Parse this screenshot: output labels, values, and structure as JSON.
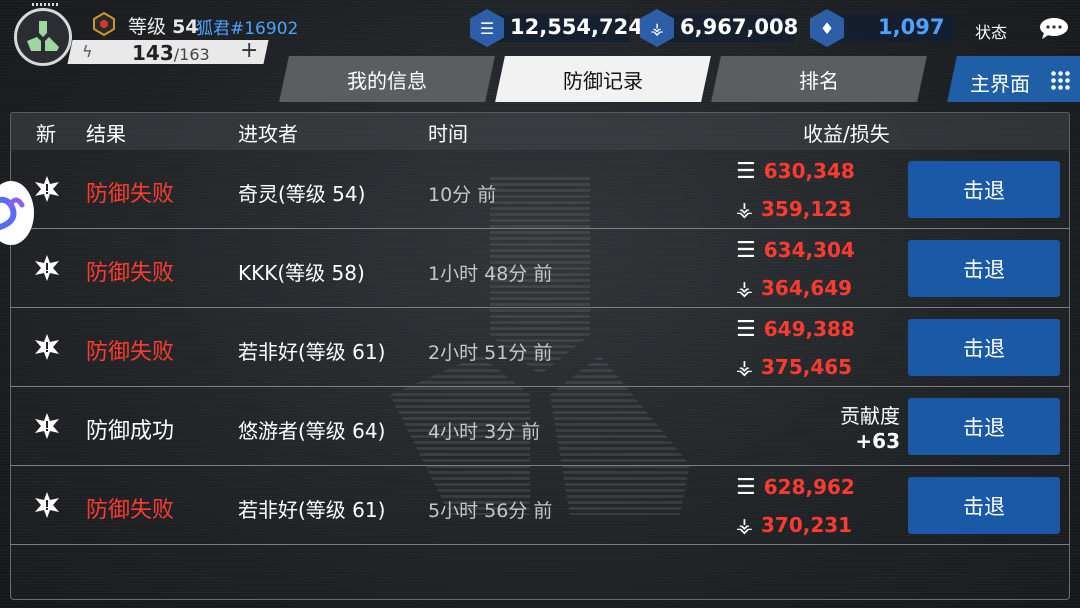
{
  "player": {
    "level_prefix": "等级",
    "level": "54",
    "name": "狐君#16902",
    "stamina_current": "143",
    "stamina_max": "/163",
    "stamina_plus": "+"
  },
  "resources": [
    {
      "icon": "alloy-icon",
      "value": "12,554,724"
    },
    {
      "icon": "crystal-icon",
      "value": "6,967,008"
    },
    {
      "icon": "premium-icon",
      "value": "1,097"
    }
  ],
  "status_label": "状态",
  "tabs": [
    "我的信息",
    "防御记录",
    "排名"
  ],
  "active_tab": "防御记录",
  "home_label": "主界面",
  "table": {
    "headers": {
      "new": "新",
      "result": "结果",
      "attacker": "进攻者",
      "time": "时间",
      "reward": "收益/损失"
    },
    "rows": [
      {
        "result": "防御失败",
        "result_color": "#ff3b30",
        "attacker": "奇灵(等级 54)",
        "time": "10分 前",
        "alloy": "630,348",
        "crystal": "359,123",
        "action": "击退"
      },
      {
        "result": "防御失败",
        "result_color": "#ff3b30",
        "attacker": "KKK(等级 58)",
        "time": "1小时 48分 前",
        "alloy": "634,304",
        "crystal": "364,649",
        "action": "击退"
      },
      {
        "result": "防御失败",
        "result_color": "#ff3b30",
        "attacker": "若非好(等级 61)",
        "time": "2小时 51分 前",
        "alloy": "649,388",
        "crystal": "375,465",
        "action": "击退"
      },
      {
        "result": "防御成功",
        "result_color": "#ffffff",
        "attacker": "悠游者(等级 64)",
        "time": "4小时 3分 前",
        "contribution_label": "贡献度",
        "contribution": "+63",
        "action": "击退"
      },
      {
        "result": "防御失败",
        "result_color": "#ff3b30",
        "attacker": "若非好(等级 61)",
        "time": "5小时 56分 前",
        "alloy": "628,962",
        "crystal": "370,231",
        "action": "击退"
      }
    ]
  },
  "colors": {
    "accent_blue": "#1a59a5",
    "loss_red": "#ff3b30",
    "name_blue": "#4da3ff"
  }
}
